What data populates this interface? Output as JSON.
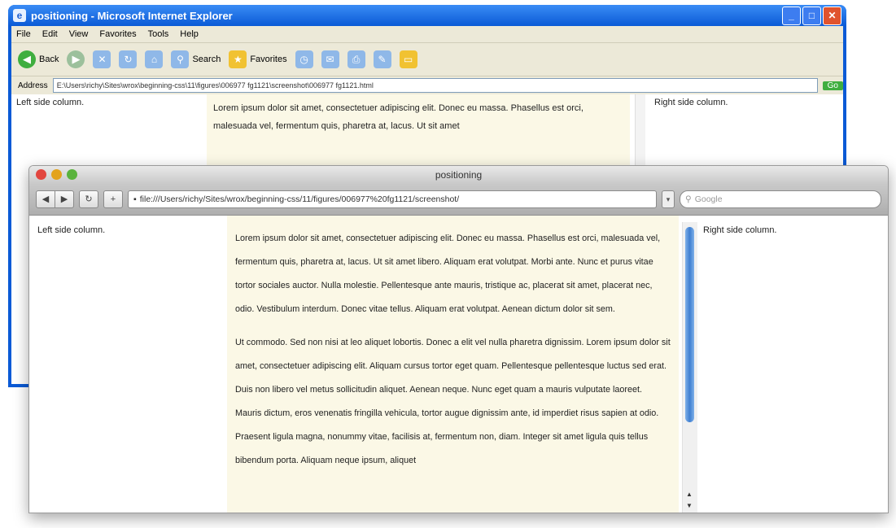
{
  "ie": {
    "title": "positioning - Microsoft Internet Explorer",
    "menu": [
      "File",
      "Edit",
      "View",
      "Favorites",
      "Tools",
      "Help"
    ],
    "toolbar": {
      "back": "Back",
      "search": "Search",
      "favorites": "Favorites"
    },
    "address_label": "Address",
    "address": "E:\\Users\\richy\\Sites\\wrox\\beginning-css\\11\\figures\\006977 fg1121\\screenshot\\006977 fg1121.html",
    "go_label": "Go",
    "left_column": "Left side column.",
    "right_column": "Right side column.",
    "center_text": "Lorem ipsum dolor sit amet, consectetuer adipiscing elit. Donec eu massa. Phasellus est orci, malesuada vel, fermentum quis, pharetra at, lacus. Ut sit amet"
  },
  "mac": {
    "title": "positioning",
    "url": "file:///Users/richy/Sites/wrox/beginning-css/11/figures/006977%20fg1121/screenshot/",
    "search_placeholder": "Google",
    "left_column": "Left side column.",
    "right_column": "Right side column.",
    "paragraphs": [
      "Lorem ipsum dolor sit amet, consectetuer adipiscing elit. Donec eu massa. Phasellus est orci, malesuada vel, fermentum quis, pharetra at, lacus. Ut sit amet libero. Aliquam erat volutpat. Morbi ante. Nunc et purus vitae tortor sociales auctor. Nulla molestie. Pellentesque ante mauris, tristique ac, placerat sit amet, placerat nec, odio. Vestibulum interdum. Donec vitae tellus. Aliquam erat volutpat. Aenean dictum dolor sit sem.",
      "Ut commodo. Sed non nisi at leo aliquet lobortis. Donec a elit vel nulla pharetra dignissim. Lorem ipsum dolor sit amet, consectetuer adipiscing elit. Aliquam cursus tortor eget quam. Pellentesque pellentesque luctus sed erat. Duis non libero vel metus sollicitudin aliquet. Aenean neque. Nunc eget quam a mauris vulputate laoreet. Mauris dictum, eros venenatis fringilla vehicula, tortor augue dignissim ante, id imperdiet risus sapien at odio. Praesent ligula magna, nonummy vitae, facilisis at, fermentum non, diam. Integer sit amet ligula quis tellus bibendum porta. Aliquam neque ipsum, aliquet"
    ]
  }
}
